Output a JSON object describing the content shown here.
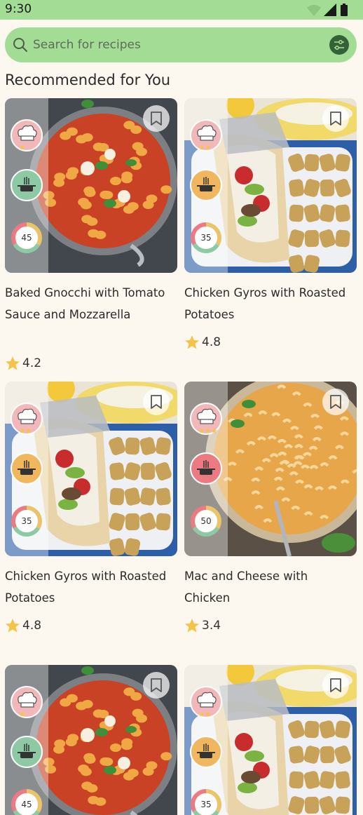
{
  "status_bar": {
    "time": "9:30"
  },
  "search": {
    "placeholder": "Search for recipes"
  },
  "section": {
    "title": "Recommended for You"
  },
  "colors": {
    "accent_green": "#a3dc94",
    "filter_dark": "#356138",
    "star": "#f5c34a",
    "background": "#fdf8ef"
  },
  "recipes": [
    {
      "title": "Baked Gnocchi with Tomato Sauce and Mozzarella",
      "rating": "4.2",
      "time": "45",
      "difficulty_stars": "★",
      "equipment_color": "#8dc9a4",
      "photo": "gnocchi"
    },
    {
      "title": "Chicken Gyros with Roasted Potatoes",
      "rating": "4.8",
      "time": "35",
      "difficulty_stars": "★★",
      "equipment_color": "#f0b75e",
      "photo": "gyros"
    },
    {
      "title": "Chicken Gyros with Roasted Potatoes",
      "rating": "4.8",
      "time": "35",
      "difficulty_stars": "★★",
      "equipment_color": "#f0b75e",
      "photo": "gyros"
    },
    {
      "title": "Mac and Cheese with Chicken",
      "rating": "3.4",
      "time": "50",
      "difficulty_stars": "★★★",
      "equipment_color": "#ec7a82",
      "photo": "mac"
    },
    {
      "title": "",
      "rating": "",
      "time": "45",
      "difficulty_stars": "★",
      "equipment_color": "#8dc9a4",
      "photo": "gnocchi"
    },
    {
      "title": "",
      "rating": "",
      "time": "35",
      "difficulty_stars": "★★",
      "equipment_color": "#f0b75e",
      "photo": "gyros"
    }
  ]
}
